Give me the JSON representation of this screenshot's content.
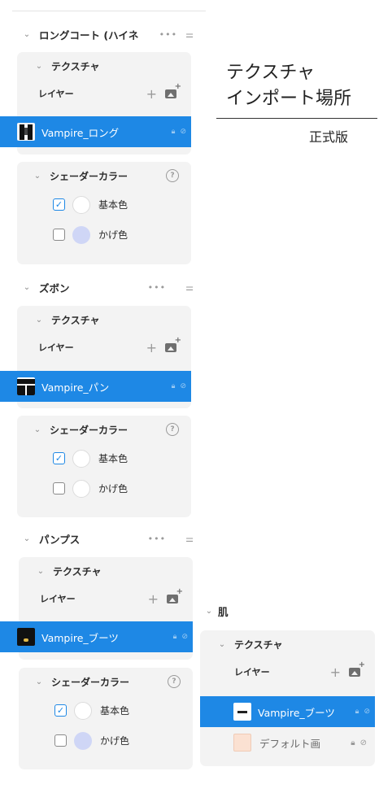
{
  "colors": {
    "accent": "#1e88e5",
    "card_bg": "#f3f3f3",
    "light_swatch": "#cfd6f6"
  },
  "groups": [
    {
      "name": "ロングコート (ハイネ",
      "texture_title": "テクスチャ",
      "layer_label": "レイヤー",
      "texture_name": "Vampire_ロング",
      "shader_title": "シェーダーカラー",
      "base_label": "基本色",
      "base_checked": true,
      "shadow_label": "かげ色",
      "shadow_checked": false
    },
    {
      "name": "ズボン",
      "texture_title": "テクスチャ",
      "layer_label": "レイヤー",
      "texture_name": "Vampire_パン",
      "shader_title": "シェーダーカラー",
      "base_label": "基本色",
      "base_checked": true,
      "shadow_label": "かげ色",
      "shadow_checked": false
    },
    {
      "name": "パンプス",
      "texture_title": "テクスチャ",
      "layer_label": "レイヤー",
      "texture_name": "Vampire_ブーツ",
      "shader_title": "シェーダーカラー",
      "base_label": "基本色",
      "base_checked": true,
      "shadow_label": "かげ色",
      "shadow_checked": false
    }
  ],
  "icons": {
    "more": "more-dots-icon",
    "tune": "tune-icon",
    "help": "help-icon",
    "add": "plus-icon",
    "add_image": "add-image-icon",
    "lock": "lock-icon",
    "hidden": "eye-off-icon",
    "chevron": "chevron-down-icon",
    "check": "check-icon"
  },
  "note": {
    "line1": "テクスチャ",
    "line2": "インポート場所",
    "sub": "正式版"
  },
  "skin": {
    "name": "肌",
    "texture_title": "テクスチャ",
    "layer_label": "レイヤー",
    "texture_name": "Vampire_ブーツ",
    "default_name": "デフォルト画"
  }
}
